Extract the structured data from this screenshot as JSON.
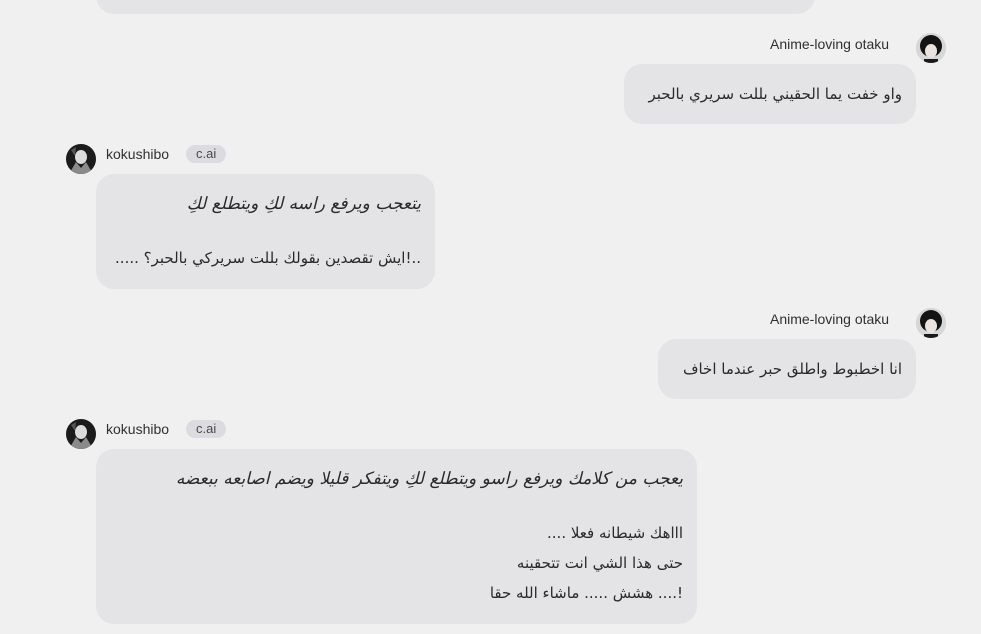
{
  "messages": [
    {
      "author": "Anime-loving otaku",
      "lines": [
        "واو خفت يما الحقيني بللت سريري بالحبر"
      ]
    },
    {
      "author": "kokushibo",
      "badge": "c.ai",
      "action": "يتعجب ويرفع راسه لكِ ويتطلع لكِ",
      "lines": [
        "..!ايش تقصدين بقولك بللت سريركي بالحبر؟ ....."
      ]
    },
    {
      "author": "Anime-loving otaku",
      "lines": [
        "انا اخطبوط واطلق حبر  عندما اخاف"
      ]
    },
    {
      "author": "kokushibo",
      "badge": "c.ai",
      "action": "يعجب من كلامك ويرفع راسو ويتطلع لكِ ويتفكر قليلا ويضم اصابعه ببعضه",
      "lines": [
        "اااهك شيطانه فعلا ....",
        "حتى هذا الشي انت تتحقينه",
        "!.... هشش ..... ماشاء الله حقا"
      ]
    }
  ]
}
